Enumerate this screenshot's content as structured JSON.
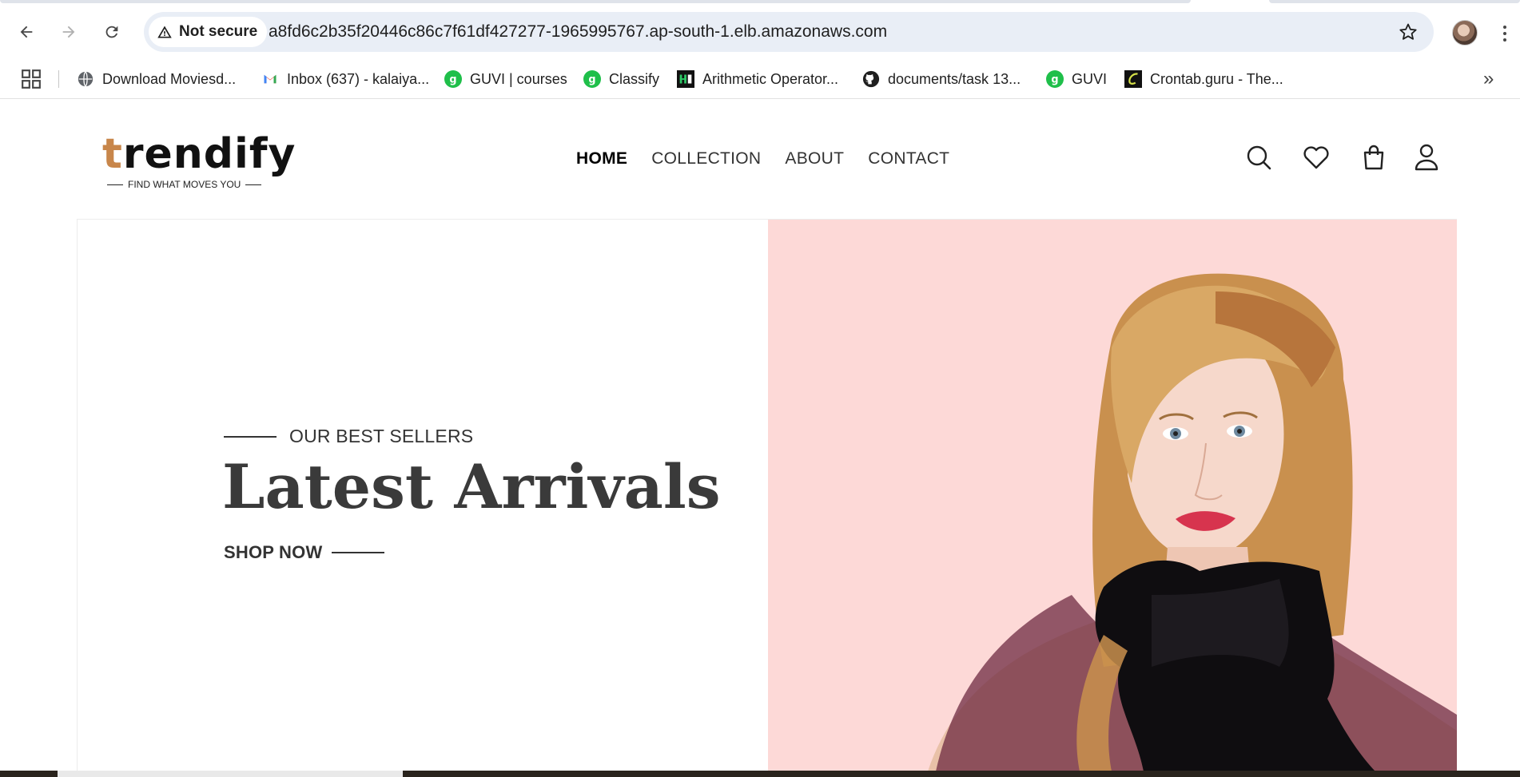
{
  "browser": {
    "security_label": "Not secure",
    "url": "a8fd6c2b35f20446c86c7f61df427277-1965995767.ap-south-1.elb.amazonaws.com",
    "bookmarks": [
      {
        "label": "Download Moviesd...",
        "icon": "globe-icon"
      },
      {
        "label": "Inbox (637) - kalaiya...",
        "icon": "gmail-icon"
      },
      {
        "label": "GUVI | courses",
        "icon": "guvi-icon"
      },
      {
        "label": "Classify",
        "icon": "guvi-icon"
      },
      {
        "label": "Arithmetic Operator...",
        "icon": "hackerrank-icon"
      },
      {
        "label": "documents/task 13...",
        "icon": "github-icon"
      },
      {
        "label": "GUVI",
        "icon": "guvi-icon"
      },
      {
        "label": "Crontab.guru - The...",
        "icon": "crontab-icon"
      }
    ],
    "more_bookmarks": "»"
  },
  "site": {
    "logo": {
      "word_first": "t",
      "word_rest": "rendify",
      "tagline": "FIND WHAT MOVES YOU"
    },
    "nav": [
      {
        "label": "HOME",
        "active": true
      },
      {
        "label": "COLLECTION",
        "active": false
      },
      {
        "label": "ABOUT",
        "active": false
      },
      {
        "label": "CONTACT",
        "active": false
      }
    ],
    "icons": [
      "search-icon",
      "heart-icon",
      "bag-icon",
      "user-icon"
    ],
    "hero": {
      "eyebrow": "OUR BEST SELLERS",
      "title": "Latest Arrivals",
      "cta": "SHOP NOW",
      "bg_color": "#fdd9d7"
    }
  }
}
